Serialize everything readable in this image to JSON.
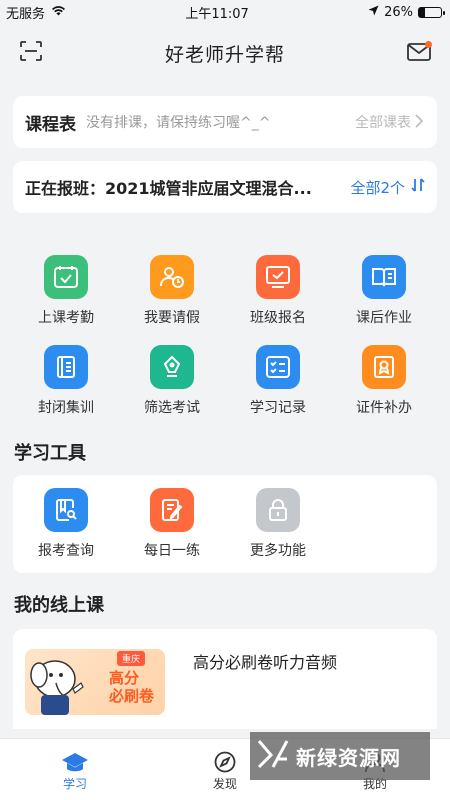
{
  "status": {
    "carrier": "无服务",
    "time": "上午11:07",
    "battery": "26%",
    "battery_level": 0.26
  },
  "header": {
    "title": "好老师升学帮"
  },
  "schedule": {
    "title": "课程表",
    "empty_text": "没有排课，请保持练习喔^_^",
    "all_label": "全部课表"
  },
  "enroll": {
    "text": "正在报班：2021城管非应届文理混合...",
    "count_label": "全部2个"
  },
  "grid": {
    "items": [
      {
        "label": "上课考勤",
        "color": "#3cbf7a"
      },
      {
        "label": "我要请假",
        "color": "#ff9a1f"
      },
      {
        "label": "班级报名",
        "color": "#ff6a3c"
      },
      {
        "label": "课后作业",
        "color": "#2c8cf0"
      },
      {
        "label": "封闭集训",
        "color": "#2c8cf0"
      },
      {
        "label": "筛选考试",
        "color": "#1fb88e"
      },
      {
        "label": "学习记录",
        "color": "#2c8cf0"
      },
      {
        "label": "证件补办",
        "color": "#ff8c1f"
      }
    ]
  },
  "tools": {
    "title": "学习工具",
    "items": [
      {
        "label": "报考查询",
        "color": "#2c8cf0"
      },
      {
        "label": "每日一练",
        "color": "#ff6a3c"
      },
      {
        "label": "更多功能",
        "color": "#c4c7cc"
      }
    ]
  },
  "online": {
    "title": "我的线上课",
    "course": {
      "name": "高分必刷卷听力音频",
      "thumb_tag": "重庆",
      "thumb_line1": "高分",
      "thumb_line2": "必刷卷"
    }
  },
  "tabs": [
    {
      "label": "学习",
      "active": true
    },
    {
      "label": "发现",
      "active": false
    },
    {
      "label": "我的",
      "active": false
    }
  ],
  "watermark": {
    "text": "新绿资源网"
  }
}
